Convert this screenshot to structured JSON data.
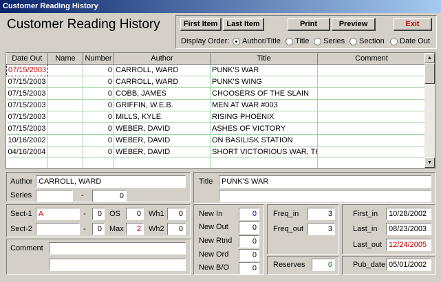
{
  "window": {
    "title": "Customer Reading History"
  },
  "header": {
    "title": "Customer Reading History"
  },
  "toolbar": {
    "first_item": "First Item",
    "last_item": "Last Item",
    "print": "Print",
    "preview": "Preview",
    "exit": "Exit"
  },
  "display_order": {
    "label": "Display Order:",
    "options": [
      "Author/Title",
      "Title",
      "Series",
      "Section",
      "Date Out"
    ],
    "selected": "Author/Title"
  },
  "grid": {
    "columns": [
      "Date Out",
      "Name",
      "Number",
      "Author",
      "Title",
      "Comment"
    ],
    "rows": [
      [
        "07/15/2003",
        "",
        "0",
        "CARROLL, WARD",
        "PUNK'S WAR",
        ""
      ],
      [
        "07/15/2003",
        "",
        "0",
        "CARROLL, WARD",
        "PUNK'S WING",
        ""
      ],
      [
        "07/15/2003",
        "",
        "0",
        "COBB, JAMES",
        "CHOOSERS OF THE SLAIN",
        ""
      ],
      [
        "07/15/2003",
        "",
        "0",
        "GRIFFIN, W.E.B.",
        "MEN AT WAR #003",
        ""
      ],
      [
        "07/15/2003",
        "",
        "0",
        "MILLS, KYLE",
        "RISING PHOENIX",
        ""
      ],
      [
        "07/15/2003",
        "",
        "0",
        "WEBER, DAVID",
        "ASHES OF VICTORY",
        ""
      ],
      [
        "10/16/2002",
        "",
        "0",
        "WEBER, DAVID",
        "ON BASILISK STATION",
        ""
      ],
      [
        "04/16/2004",
        "",
        "0",
        "WEBER, DAVID",
        "SHORT VICTORIOUS WAR, THE",
        ""
      ]
    ]
  },
  "detail": {
    "author_label": "Author",
    "author": "CARROLL, WARD",
    "series_label": "Series",
    "series": "",
    "series_dash": "-",
    "series_num": "0",
    "title_label": "Title",
    "title": "PUNK'S WAR",
    "title2": "",
    "sect1_label": "Sect-1",
    "sect1": "A",
    "sect1_dash": "-",
    "sect1_num": "0",
    "os_label": "OS",
    "os": "0",
    "wh1_label": "Wh1",
    "wh1": "0",
    "sect2_label": "Sect-2",
    "sect2": "",
    "sect2_dash": "-",
    "sect2_num": "0",
    "max_label": "Max",
    "max": "2",
    "wh2_label": "Wh2",
    "wh2": "0",
    "comment_label": "Comment",
    "comment1": "",
    "comment2": "",
    "new_in_label": "New In",
    "new_in": "0",
    "new_out_label": "New Out",
    "new_out": "0",
    "new_rtnd_label": "New Rtnd",
    "new_rtnd": "0",
    "new_ord_label": "New Ord",
    "new_ord": "0",
    "new_bo_label": "New B/O",
    "new_bo": "0",
    "freq_in_label": "Freq_in",
    "freq_in": "3",
    "freq_out_label": "Freq_out",
    "freq_out": "3",
    "reserves_label": "Reserves",
    "reserves": "0",
    "first_in_label": "First_in",
    "first_in": "10/28/2002",
    "last_in_label": "Last_in",
    "last_in": "08/23/2003",
    "last_out_label": "Last_out",
    "last_out": "12/24/2005",
    "pub_date_label": "Pub_date",
    "pub_date": "05/01/2002"
  },
  "colors": {
    "accent_red": "#c00000",
    "value_blue": "#0000c0",
    "value_green": "#008000",
    "grid_line": "#9fd89f"
  },
  "icons": {
    "scroll_up": "scroll-up-icon",
    "scroll_down": "scroll-down-icon"
  }
}
